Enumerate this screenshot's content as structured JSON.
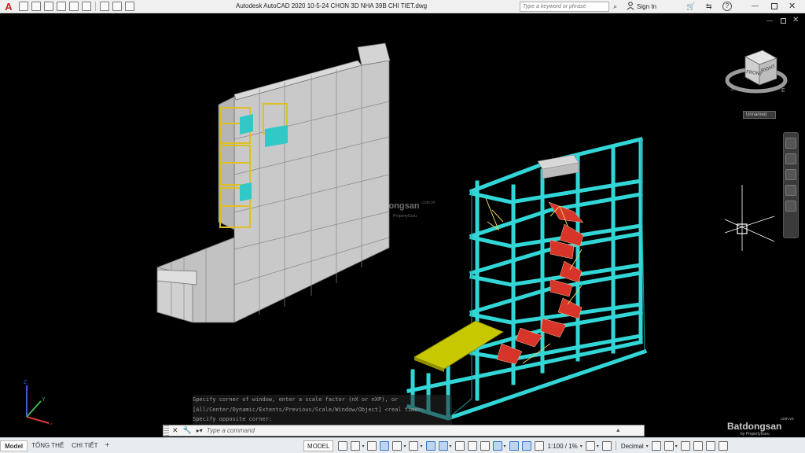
{
  "app": {
    "logo_letter": "A",
    "window_title": "Autodesk AutoCAD 2020    10-5-24 CHON 3D NHA 39B CHI TIET.dwg",
    "search_placeholder": "Type a keyword or phrase",
    "sign_in_label": "Sign In"
  },
  "viewport": {
    "view_name": "Unnamed",
    "viewcube_faces": {
      "front": "FRONT",
      "right": "RIGHT"
    },
    "compass": {
      "south": "S",
      "east": "E"
    },
    "ucs_axes": {
      "x": "X",
      "y": "Y",
      "z": "Z"
    }
  },
  "command_history": [
    "Specify corner of window, enter a scale factor (nX or nXP), or",
    "[All/Center/Dynamic/Extents/Previous/Scale/Window/Object] <real time>:",
    "Specify opposite corner:"
  ],
  "command_line": {
    "placeholder": "Type a command"
  },
  "layout_tabs": [
    {
      "label": "Model",
      "active": true
    },
    {
      "label": "TỔNG THỂ",
      "active": false
    },
    {
      "label": "CHI TIẾT",
      "active": false
    }
  ],
  "status_bar": {
    "model_label": "MODEL",
    "annotation_scale": "1:100 / 1%",
    "units": "Decimal"
  },
  "watermark": {
    "brand": "Batdongsan",
    "domain_suffix": ".com.vn",
    "center_sub": "PropertyGuru",
    "corner_sub": "by PropertyGuru"
  },
  "colors": {
    "background": "#000000",
    "structure_cyan": "#33d6d6",
    "stair_red": "#d8352a",
    "canopy_yellow": "#c8c800",
    "facade_grey": "#c8c8c8",
    "railing_yellow": "#e0c020",
    "brand_red": "#d21f1f"
  }
}
